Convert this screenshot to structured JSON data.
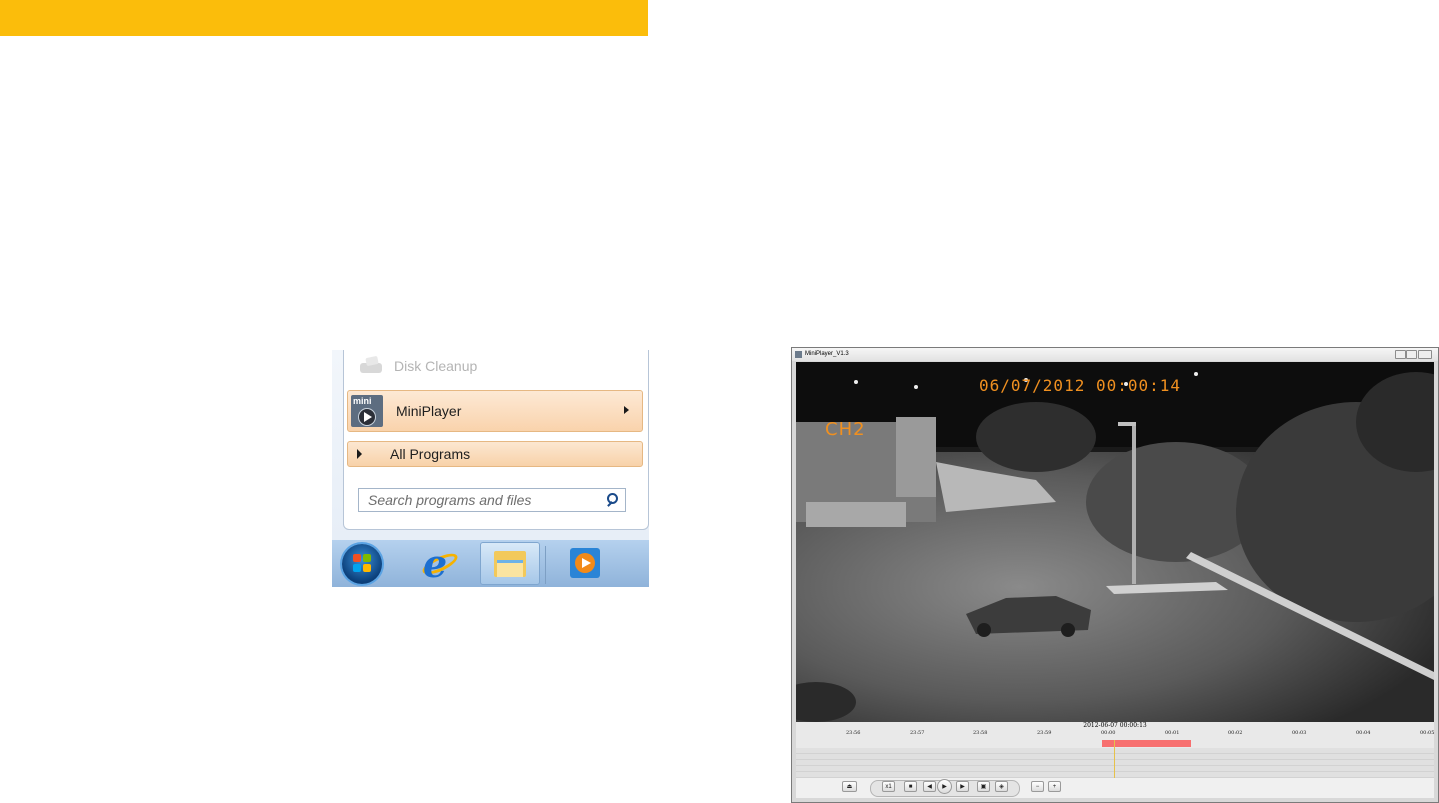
{
  "start_menu": {
    "disk_cleanup_label": "Disk Cleanup",
    "mini_icon_text": "mini",
    "miniplayer_label": "MiniPlayer",
    "all_programs_label": "All Programs",
    "search_placeholder": "Search programs and files"
  },
  "taskbar": {
    "icons": [
      "windows-start-orb",
      "internet-explorer-icon",
      "windows-explorer-icon",
      "media-player-icon"
    ]
  },
  "miniplayer": {
    "window_title": "MiniPlayer_V1.3",
    "osd_datetime": "06/07/2012  00:00:14",
    "osd_channel": "CH2",
    "timeline_current": "2012-06-07 00:00:13",
    "timeline_ticks": [
      "23:56",
      "23:57",
      "23:58",
      "23:59",
      "00:00",
      "00:01",
      "00:02",
      "00:03",
      "00:04",
      "00:05"
    ],
    "timeline_bar_color": "#f76f6f",
    "speed_label": "x1"
  },
  "colors": {
    "accent_bar": "#fbbd0b",
    "menu_highlight": "#f9d3ac",
    "osd_text": "#f09020"
  }
}
